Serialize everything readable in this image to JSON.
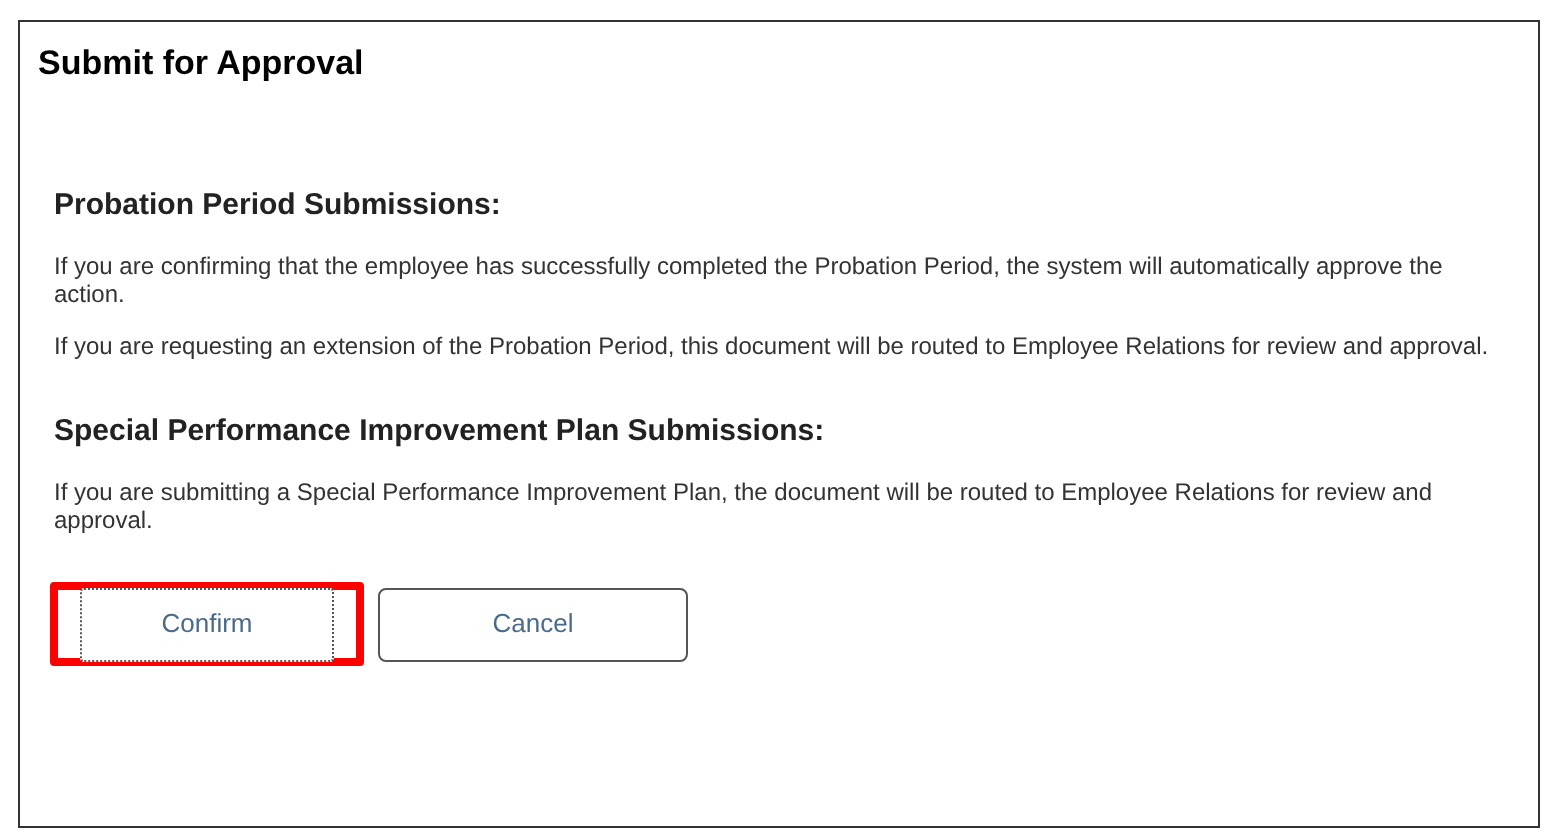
{
  "dialog": {
    "title": "Submit for Approval"
  },
  "sections": [
    {
      "heading": "Probation Period Submissions:",
      "paragraphs": [
        "If you are confirming that the employee has successfully completed the Probation Period, the system will automatically approve the action.",
        "If you are requesting an extension of the Probation Period, this document will be routed to Employee Relations for review and approval."
      ]
    },
    {
      "heading": "Special Performance Improvement Plan Submissions:",
      "paragraphs": [
        "If you are submitting a Special Performance Improvement Plan, the document will be routed to Employee Relations for review and approval."
      ]
    }
  ],
  "buttons": [
    {
      "label": "Confirm",
      "focused": true,
      "highlighted": true
    },
    {
      "label": "Cancel",
      "focused": false,
      "highlighted": false
    }
  ]
}
